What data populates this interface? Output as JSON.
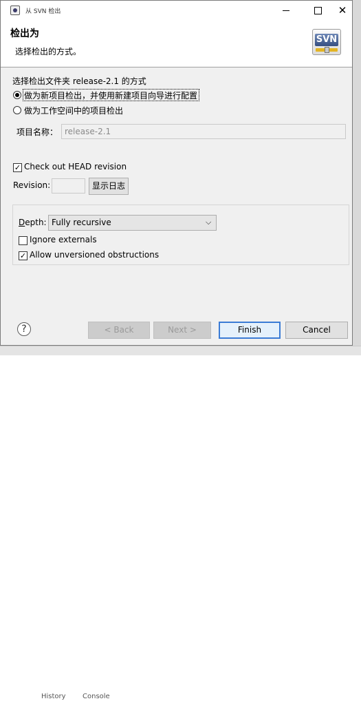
{
  "window": {
    "title": "从 SVN 检出"
  },
  "header": {
    "title": "检出为",
    "description": "选择检出的方式。",
    "logo_text": "SVN"
  },
  "checkout": {
    "prompt": "选择检出文件夹 release-2.1 的方式",
    "option_wizard": "做为新项目检出，并使用新建项目向导进行配置",
    "option_workspace": "做为工作空间中的项目检出",
    "project_name_label": "项目名称：",
    "project_name_value": "release-2.1"
  },
  "revision": {
    "head_checkbox_label": "Check out HEAD revision",
    "head_checked": true,
    "revision_label": "Revision:",
    "revision_value": "",
    "show_log_button": "显示日志"
  },
  "options": {
    "depth_label": "Depth:",
    "depth_value": "Fully recursive",
    "ignore_externals_label": "Ignore externals",
    "ignore_externals_checked": false,
    "allow_unversioned_label": "Allow unversioned obstructions",
    "allow_unversioned_checked": true
  },
  "buttons": {
    "back": "< Back",
    "next": "Next >",
    "finish": "Finish",
    "cancel": "Cancel"
  },
  "background_tabs": {
    "history": "History",
    "console": "Console"
  },
  "colors": {
    "accent": "#3a7bd5",
    "dialog_bg": "#f0f0f0"
  },
  "icons": {
    "help": "help-icon",
    "svn_logo": "svn-logo",
    "window_icon": "eclipse-icon"
  }
}
